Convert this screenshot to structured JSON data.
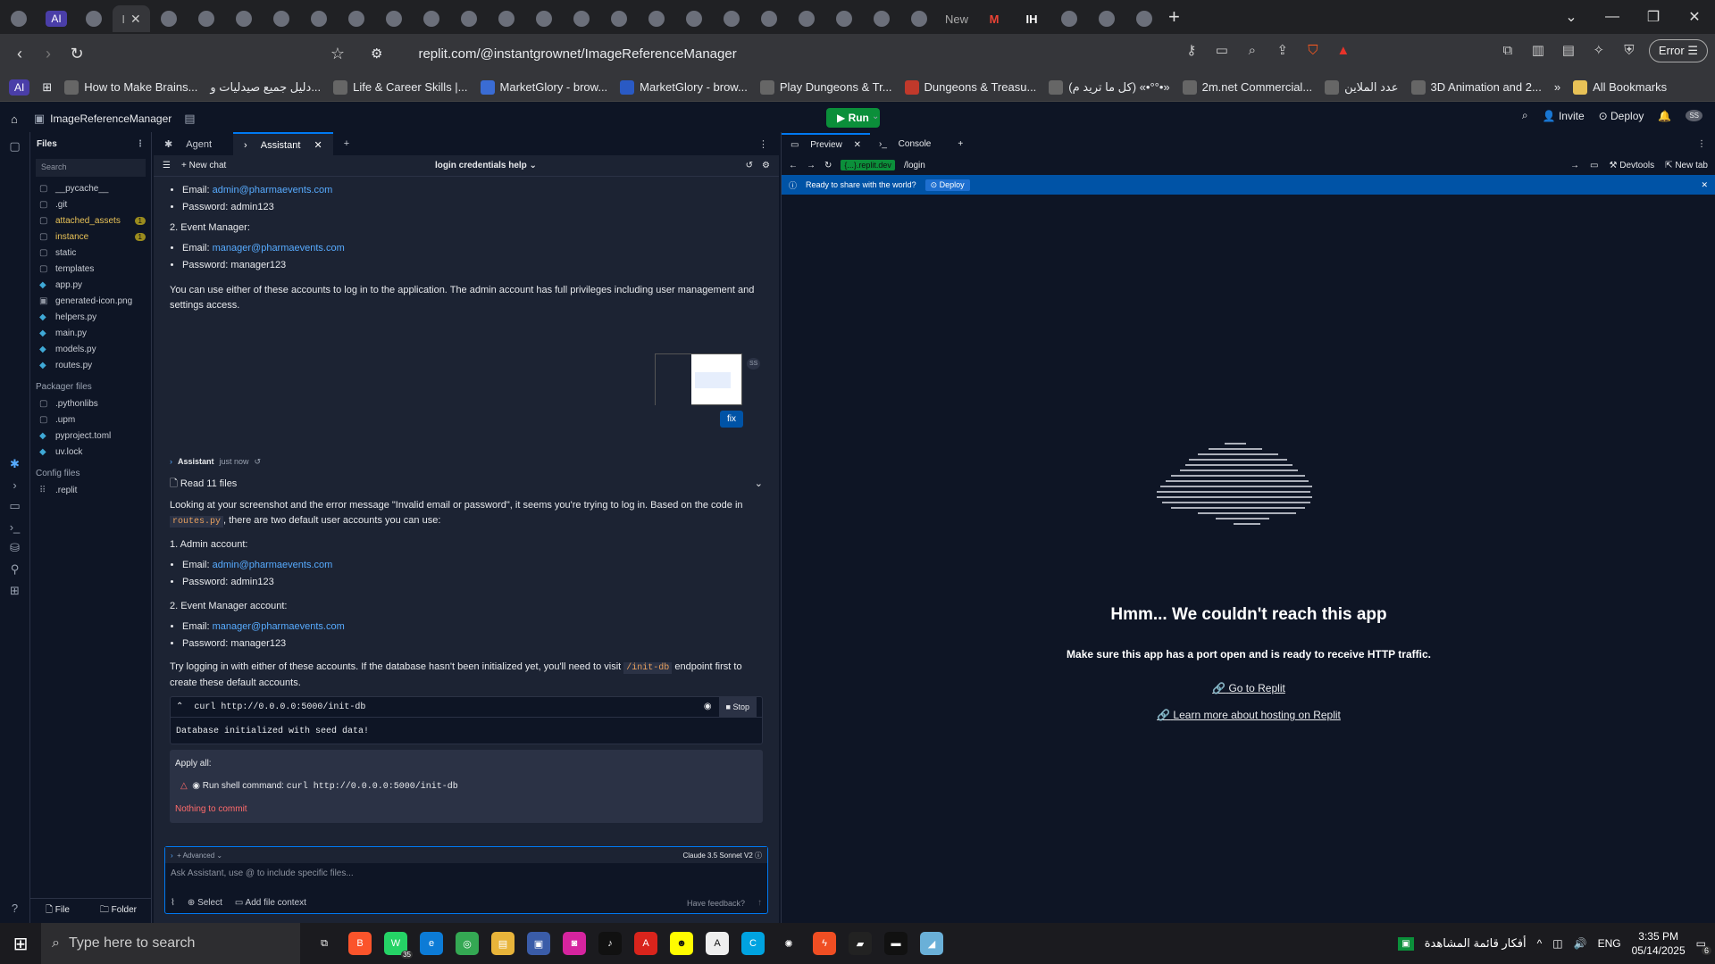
{
  "browser": {
    "tabs_count_visible": 31,
    "active_tab_label": "I",
    "other_tab_labels": [
      "AI",
      "New",
      "M",
      "IH"
    ],
    "url": "replit.com/@instantgrownet/ImageReferenceManager",
    "error_label": "Error",
    "bookmarks": [
      "How to Make Brains...",
      "دليل جميع صيدليات و...",
      "Life & Career Skills |...",
      "MarketGlory - brow...",
      "MarketGlory - brow...",
      "Play Dungeons & Tr...",
      "Dungeons & Treasu...",
      "(كل ما تريد م) «•°°•»",
      "2m.net Commercial...",
      "عدد الملاين",
      "3D Animation and 2..."
    ],
    "all_bookmarks": "All Bookmarks",
    "ai_badge": "AI"
  },
  "replit": {
    "project": "ImageReferenceManager",
    "run": "Run",
    "invite": "Invite",
    "deploy": "Deploy",
    "avatar": "SS"
  },
  "files": {
    "title": "Files",
    "search": "Search",
    "items": [
      {
        "name": "__pycache__",
        "icon": "folder"
      },
      {
        "name": ".git",
        "icon": "folder"
      },
      {
        "name": "attached_assets",
        "icon": "folder",
        "badge": "1"
      },
      {
        "name": "instance",
        "icon": "folder",
        "badge": "1"
      },
      {
        "name": "static",
        "icon": "folder"
      },
      {
        "name": "templates",
        "icon": "folder"
      },
      {
        "name": "app.py",
        "icon": "python"
      },
      {
        "name": "generated-icon.png",
        "icon": "image"
      },
      {
        "name": "helpers.py",
        "icon": "python"
      },
      {
        "name": "main.py",
        "icon": "python"
      },
      {
        "name": "models.py",
        "icon": "python"
      },
      {
        "name": "routes.py",
        "icon": "python"
      }
    ],
    "packager_title": "Packager files",
    "packager": [
      ".pythonlibs",
      ".upm",
      "pyproject.toml",
      "uv.lock"
    ],
    "config_title": "Config files",
    "config": [
      ".replit"
    ],
    "file_btn": "File",
    "folder_btn": "Folder"
  },
  "chat": {
    "tabs": [
      "Agent",
      "Assistant"
    ],
    "new_chat": "New chat",
    "title": "login credentials help",
    "m1": {
      "email1": "admin@pharmaevents.com",
      "pass1": "Password: admin123",
      "em_head": "2. Event Manager:",
      "email2": "manager@pharmaevents.com",
      "pass2": "Password: manager123",
      "note": "You can use either of these accounts to log in to the application. The admin account has full privileges including user management and settings access."
    },
    "fix": "fix",
    "avatar_small": "SS",
    "assistant_name": "Assistant",
    "time": "just now",
    "read_files": "Read 11 files",
    "m2": {
      "intro_a": "Looking at your screenshot and the error message \"Invalid email or password\", it seems you're trying to log in. Based on the code in",
      "intro_code": "routes.py",
      "intro_b": ", there are two default user accounts you can use:",
      "admin_head": "1. Admin account:",
      "email_label": "Email:",
      "email1": "admin@pharmaevents.com",
      "pass1": "Password: admin123",
      "em_head": "2. Event Manager account:",
      "email2": "manager@pharmaevents.com",
      "pass2": "Password: manager123",
      "try_a": "Try logging in with either of these accounts. If the database hasn't been initialized yet, you'll need to visit",
      "try_code": "/init-db",
      "try_b": "endpoint first to create these default accounts."
    },
    "cmd": "curl http://0.0.0.0:5000/init-db",
    "stop": "Stop",
    "cmd_out": "Database initialized with seed data!",
    "apply_all": "Apply all:",
    "apply_label": "Run shell command:",
    "nothing": "Nothing to commit",
    "advanced": "Advanced",
    "model": "Claude 3.5 Sonnet V2",
    "placeholder": "Ask Assistant, use @ to include specific files...",
    "select": "Select",
    "add_context": "Add file context",
    "feedback": "Have feedback?"
  },
  "preview": {
    "tabs": [
      "Preview",
      "Console"
    ],
    "domain": "{...}.replit.dev",
    "path": "/login",
    "devtools": "Devtools",
    "newtab": "New tab",
    "share": "Ready to share with the world?",
    "deploy": "Deploy",
    "error_title": "Hmm... We couldn't reach this app",
    "error_sub": "Make sure this app has a port open and is ready to receive HTTP traffic.",
    "link1": "Go to Replit",
    "link2": "Learn more about hosting on Replit"
  },
  "taskbar": {
    "search": "Type here to search",
    "badge": "35",
    "arabic": "أفكار قائمة المشاهدة",
    "lang": "ENG",
    "time": "3:35 PM",
    "date": "05/14/2025",
    "notif": "6"
  }
}
